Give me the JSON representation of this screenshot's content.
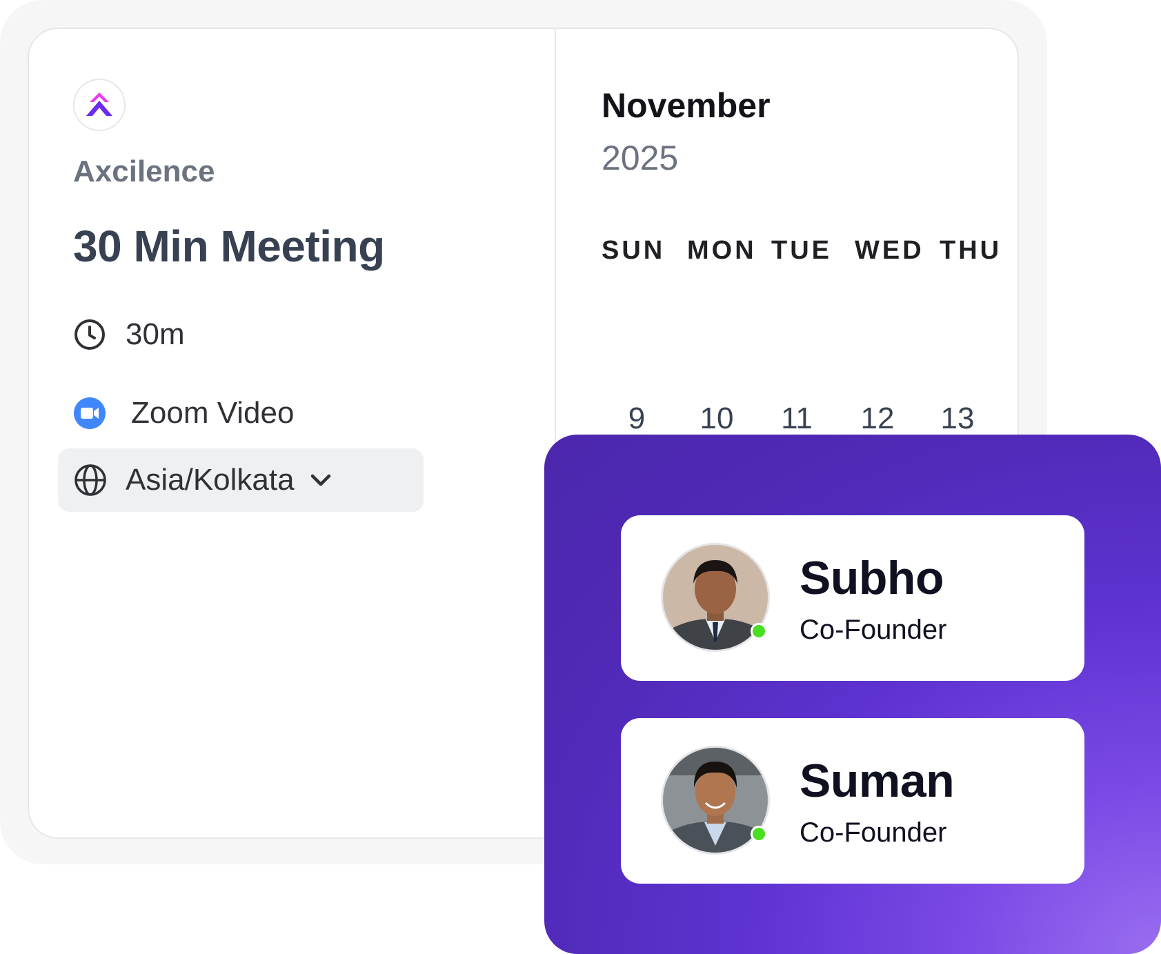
{
  "booking": {
    "org_name": "Axcilence",
    "event_title": "30 Min Meeting",
    "duration": "30m",
    "location": "Zoom Video",
    "timezone": "Asia/Kolkata"
  },
  "calendar": {
    "month": "November",
    "year": "2025",
    "weekdays": [
      "SUN",
      "MON",
      "TUE",
      "WED",
      "THU"
    ],
    "visible_days": [
      "9",
      "10",
      "11",
      "12",
      "13"
    ]
  },
  "team": [
    {
      "name": "Subho",
      "role": "Co-Founder",
      "status": "online"
    },
    {
      "name": "Suman",
      "role": "Co-Founder",
      "status": "online"
    }
  ],
  "icons": {
    "logo": "axcilence-logo-icon",
    "duration": "clock-icon",
    "location": "zoom-video-icon",
    "timezone": "globe-icon",
    "dropdown": "chevron-down-icon"
  },
  "colors": {
    "panel_purple": "#5029b6",
    "zoom_blue": "#4087fc",
    "online_green": "#4ade20",
    "logo_magenta": "#e83cf0",
    "logo_violet": "#6b2cf0"
  }
}
